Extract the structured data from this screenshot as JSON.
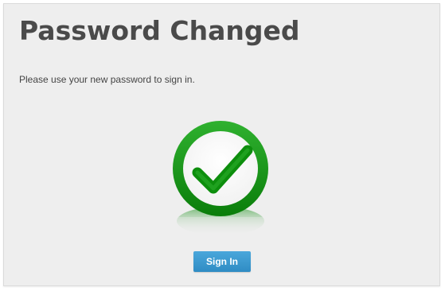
{
  "page": {
    "title": "Password Changed",
    "message": "Please use your new password to sign in."
  },
  "status_icon": {
    "name": "checkmark-circle-icon",
    "color": "#1a9a1a"
  },
  "actions": {
    "signin_label": "Sign In",
    "button_color": "#3a9bd2"
  }
}
